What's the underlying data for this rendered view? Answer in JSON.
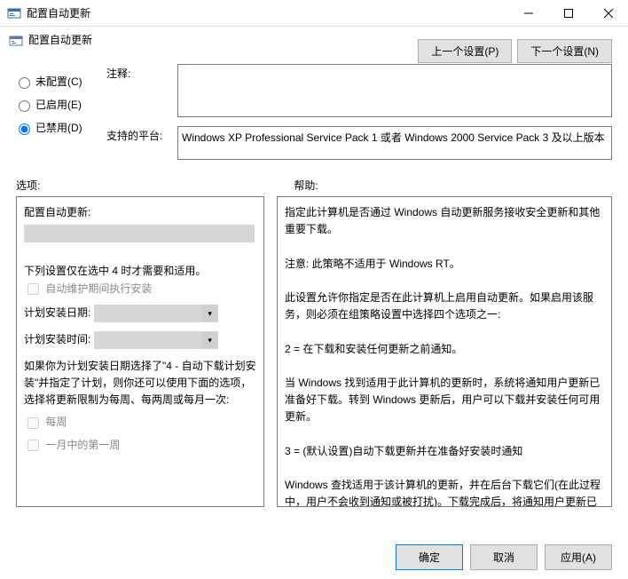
{
  "titlebar": {
    "title": "配置自动更新"
  },
  "header": {
    "title": "配置自动更新"
  },
  "nav": {
    "prev": "上一个设置(P)",
    "next": "下一个设置(N)"
  },
  "radios": {
    "not_configured": "未配置(C)",
    "enabled": "已启用(E)",
    "disabled": "已禁用(D)"
  },
  "labels": {
    "comment": "注释:",
    "platform": "支持的平台:",
    "options": "选项:",
    "help": "帮助:"
  },
  "platform_text": "Windows XP Professional Service Pack 1 或者 Windows 2000 Service Pack 3 及以上版本",
  "options": {
    "title": "配置自动更新:",
    "note": "下列设置仅在选中 4 时才需要和适用。",
    "maintenance": "自动维护期间执行安装",
    "date_label": "计划安装日期:",
    "time_label": "计划安装时间:",
    "schedule_note": "如果你为计划安装日期选择了\"4 - 自动下载计划安装\"并指定了计划，则你还可以使用下面的选项，选择将更新限制为每周、每两周或每月一次:",
    "weekly": "每周",
    "first_week": "一月中的第一周"
  },
  "help": {
    "p1": "指定此计算机是否通过 Windows 自动更新服务接收安全更新和其他重要下载。",
    "p2": "注意: 此策略不适用于 Windows RT。",
    "p3": "此设置允许你指定是否在此计算机上启用自动更新。如果启用该服务，则必须在组策略设置中选择四个选项之一:",
    "p4": "2 = 在下载和安装任何更新之前通知。",
    "p5": " 当 Windows 找到适用于此计算机的更新时，系统将通知用户更新已准备好下载。转到 Windows 更新后，用户可以下载并安装任何可用更新。",
    "p6": "3 = (默认设置)自动下载更新并在准备好安装时通知",
    "p7": " Windows 查找适用于该计算机的更新，并在后台下载它们(在此过程中，用户不会收到通知或被打扰)。下载完成后，将通知用户更新已准备好进行安装。在转到 Windows 更新后，用户可以安装它们。"
  },
  "footer": {
    "ok": "确定",
    "cancel": "取消",
    "apply": "应用(A)"
  }
}
